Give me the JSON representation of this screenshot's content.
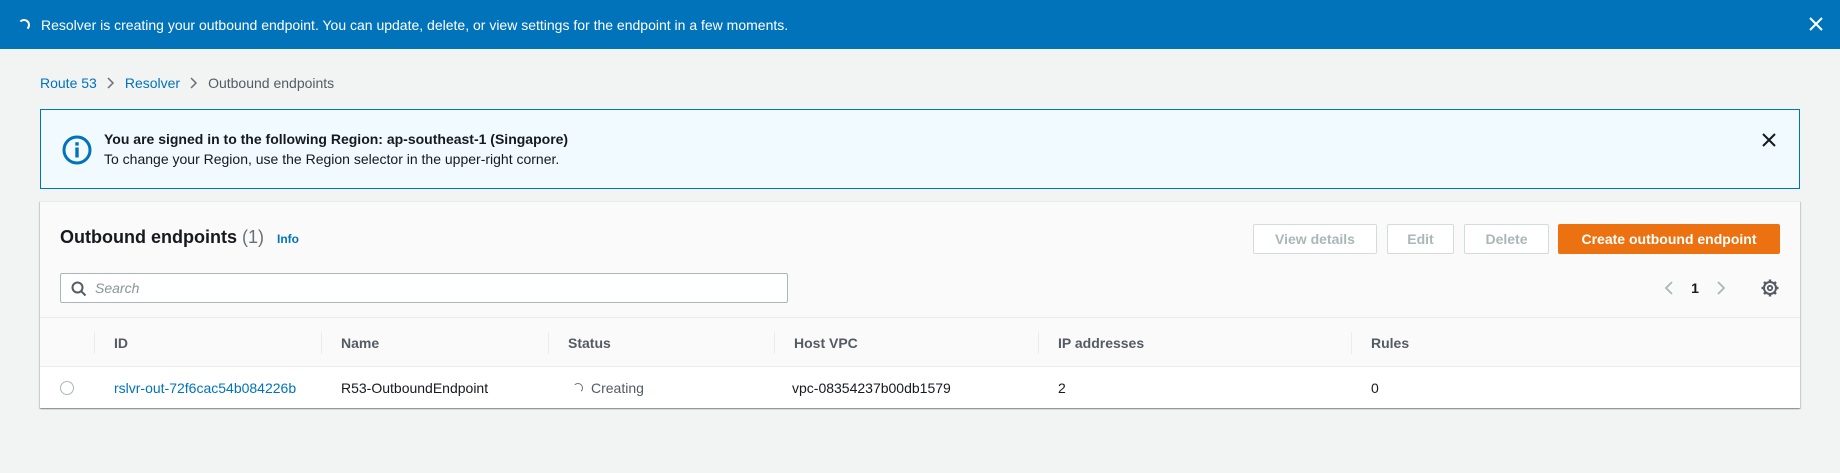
{
  "flash": {
    "message": "Resolver is creating your outbound endpoint. You can update, delete, or view settings for the endpoint in a few moments."
  },
  "breadcrumb": {
    "items": [
      "Route 53",
      "Resolver"
    ],
    "current": "Outbound endpoints"
  },
  "region_alert": {
    "title": "You are signed in to the following Region: ap-southeast-1 (Singapore)",
    "body": "To change your Region, use the Region selector in the upper-right corner."
  },
  "table": {
    "title": "Outbound endpoints",
    "count": "(1)",
    "info_link": "Info",
    "buttons": {
      "view_details": "View details",
      "edit": "Edit",
      "delete": "Delete",
      "create": "Create outbound endpoint"
    },
    "search_placeholder": "Search",
    "current_page": "1",
    "columns": [
      "ID",
      "Name",
      "Status",
      "Host VPC",
      "IP addresses",
      "Rules"
    ],
    "rows": [
      {
        "id": "rslvr-out-72f6cac54b084226b",
        "name": "R53-OutboundEndpoint",
        "status": "Creating",
        "host_vpc": "vpc-08354237b00db1579",
        "ip_addresses": "2",
        "rules": "0"
      }
    ]
  },
  "colors": {
    "flash_bg": "#0073bb",
    "primary_button": "#ec7211",
    "link": "#0073bb",
    "alert_bg": "#f1faff"
  }
}
